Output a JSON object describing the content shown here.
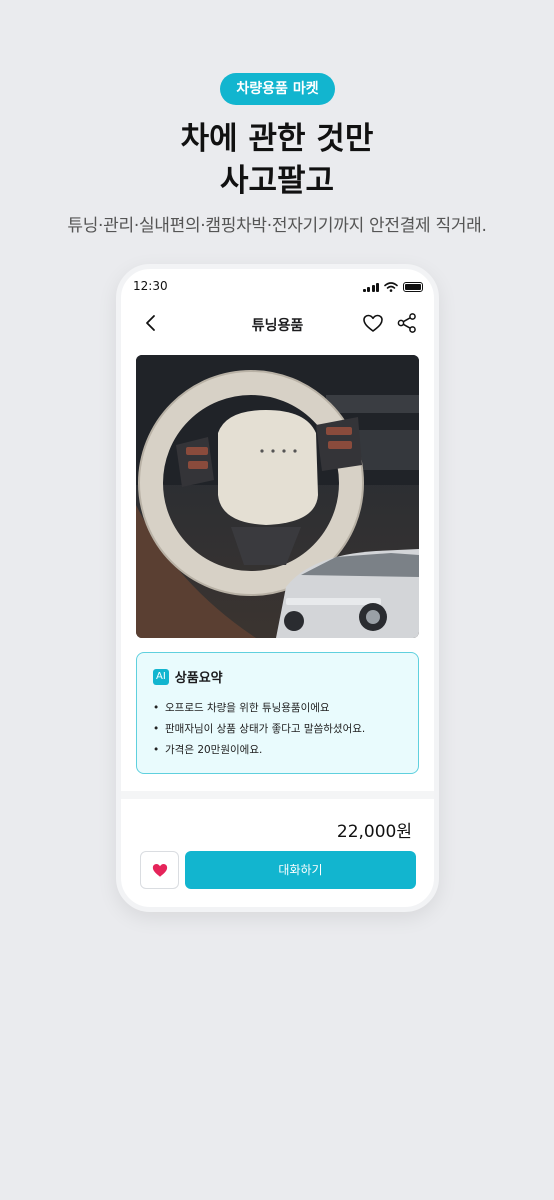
{
  "promo": {
    "badge": "차량용품 마켓",
    "headline_line1": "차에 관한 것만",
    "headline_line2": "사고팔고",
    "subline": "튜닝·관리·실내편의·캠핑차박·전자기기까지 안전결제 직거래."
  },
  "status_bar": {
    "time": "12:30",
    "icons": [
      "signal-icon",
      "wifi-icon",
      "battery-icon"
    ]
  },
  "header": {
    "title": "튜닝용품",
    "icons": [
      "back-arrow-icon",
      "heart-outline-icon",
      "share-icon"
    ]
  },
  "summary": {
    "ai_label": "AI",
    "title": "상품요약",
    "items": [
      "오프로드 차량을 위한 튜닝용품이에요",
      "판매자님이 상품 상태가 좋다고 말씀하셨어요.",
      "가격은 20만원이에요."
    ]
  },
  "footer": {
    "price": "22,000원",
    "chat_label": "대화하기"
  },
  "colors": {
    "accent": "#12b5cf",
    "summary_bg": "#e9fbfd",
    "like_heart": "#e5245a",
    "background": "#eaebee"
  }
}
